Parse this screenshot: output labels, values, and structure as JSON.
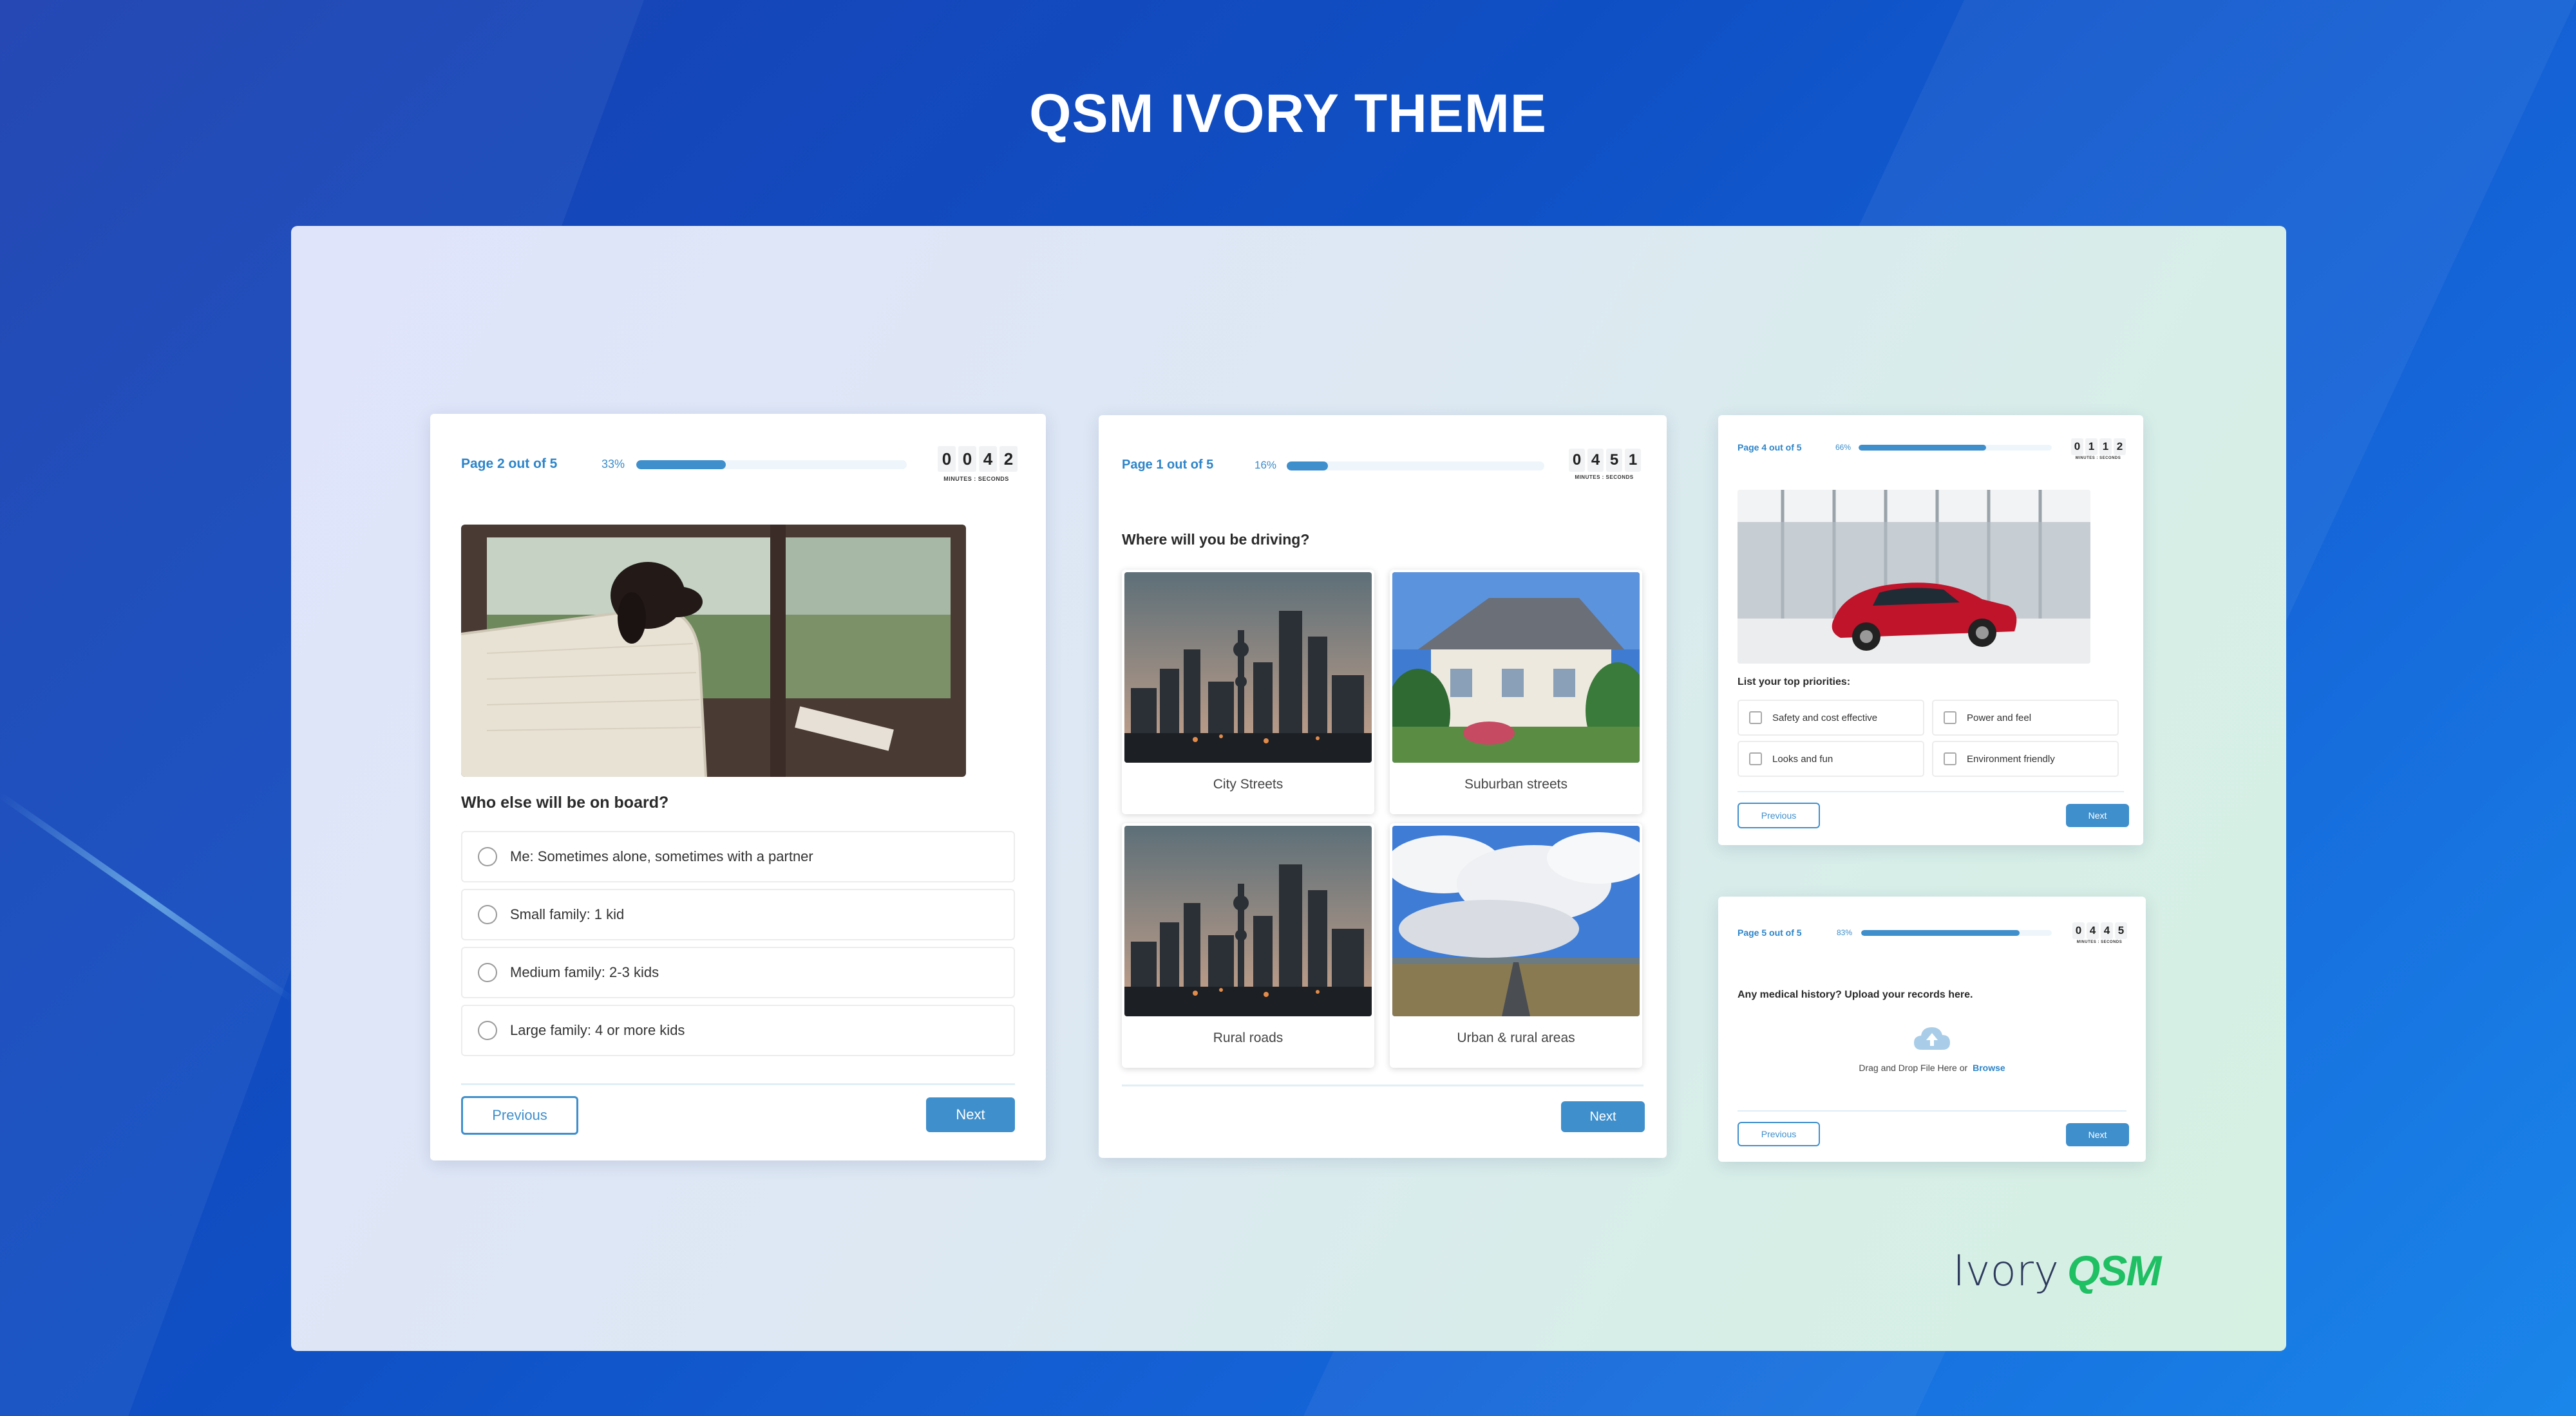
{
  "title": "QSM IVORY THEME",
  "colors": {
    "accent": "#3f8fcc",
    "brand_green": "#1fbf63"
  },
  "card1": {
    "page": "Page 2 out of 5",
    "progress_label": "33%",
    "progress": 0.33,
    "timer_digits": [
      "0",
      "0",
      "4",
      "2"
    ],
    "timer_caption": "MINUTES : SECONDS",
    "question": "Who else will be on board?",
    "options": [
      "Me: Sometimes alone, sometimes with a partner",
      "Small family: 1 kid",
      "Medium family: 2-3 kids",
      "Large family: 4 or more kids"
    ],
    "previous": "Previous",
    "next": "Next"
  },
  "card2": {
    "page": "Page 1 out of 5",
    "progress_label": "16%",
    "progress": 0.16,
    "timer_digits": [
      "0",
      "4",
      "5",
      "1"
    ],
    "timer_caption": "MINUTES : SECONDS",
    "question": "Where will you be driving?",
    "tiles": [
      "City Streets",
      "Suburban streets",
      "Rural roads",
      "Urban & rural areas"
    ],
    "next": "Next"
  },
  "card3": {
    "page": "Page 4 out of 5",
    "progress_label": "66%",
    "progress": 0.66,
    "timer_digits": [
      "0",
      "1",
      "1",
      "2"
    ],
    "timer_caption": "MINUTES : SECONDS",
    "question": "List your top priorities:",
    "options": [
      "Safety and cost effective",
      "Power and feel",
      "Looks and fun",
      "Environment friendly"
    ],
    "previous": "Previous",
    "next": "Next"
  },
  "card4": {
    "page": "Page 5 out of 5",
    "progress_label": "83%",
    "progress": 0.83,
    "timer_digits": [
      "0",
      "4",
      "4",
      "5"
    ],
    "timer_caption": "MINUTES : SECONDS",
    "question": "Any medical history? Upload your records here.",
    "upload_text": "Drag and Drop File Here or",
    "browse": "Browse",
    "previous": "Previous",
    "next": "Next"
  },
  "brand": {
    "word": "Ivory",
    "logo": "QSM"
  }
}
